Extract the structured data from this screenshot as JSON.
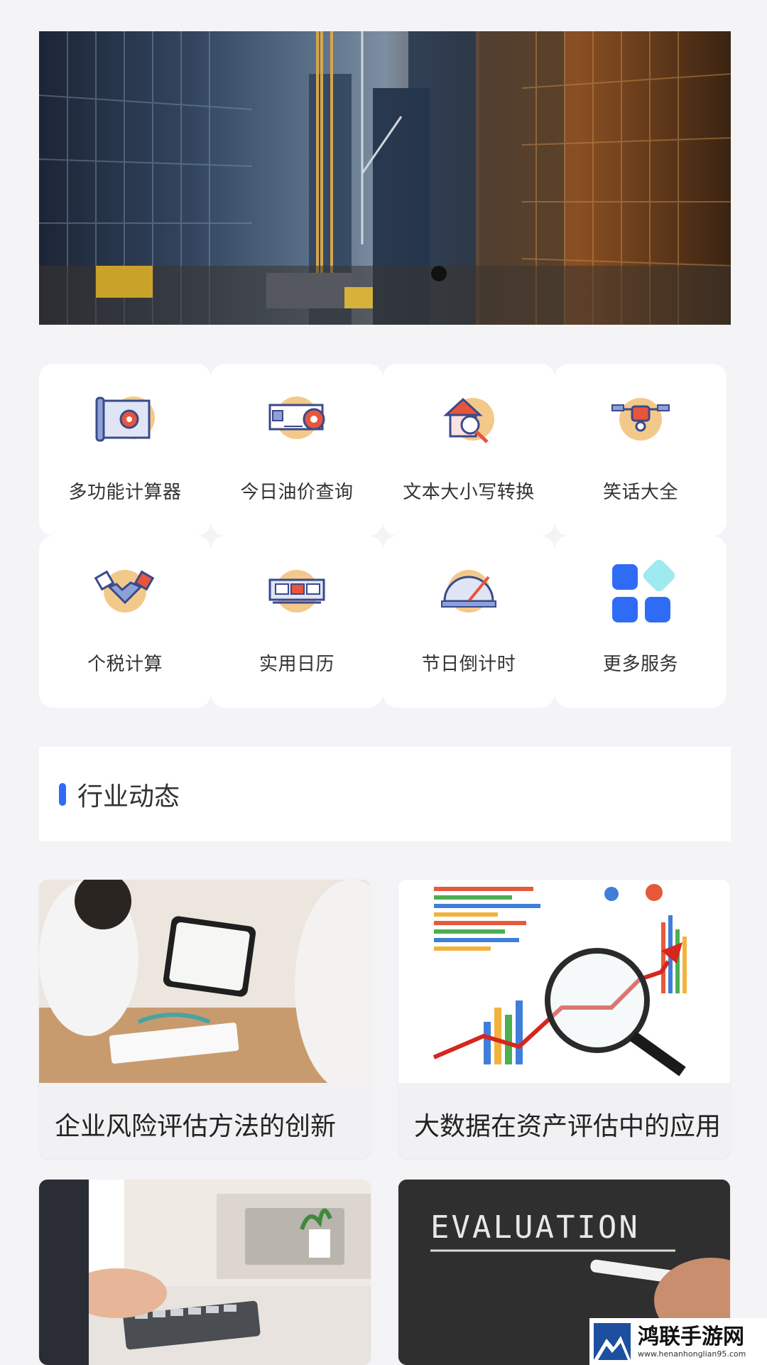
{
  "banner": {
    "image": "construction-city-photo",
    "page_indicator_active": 1
  },
  "services": [
    {
      "label": "多功能计算器",
      "icon": "blueprint-gear-icon"
    },
    {
      "label": "今日油价查询",
      "icon": "measuring-tape-icon"
    },
    {
      "label": "文本大小写转换",
      "icon": "house-magnifier-icon"
    },
    {
      "label": "笑话大全",
      "icon": "drone-icon"
    },
    {
      "label": "个税计算",
      "icon": "handshake-icon"
    },
    {
      "label": "实用日历",
      "icon": "panel-calendar-icon"
    },
    {
      "label": "节日倒计时",
      "icon": "protractor-icon"
    },
    {
      "label": "更多服务",
      "icon": "more-grid-icon"
    }
  ],
  "section": {
    "title": "行业动态"
  },
  "articles": [
    {
      "title": "企业风险评估方法的创新",
      "image": "consultation-photo"
    },
    {
      "title": "大数据在资产评估中的应用",
      "image": "chart-magnifier-photo"
    },
    {
      "title": "",
      "image": "calculator-laptop-photo"
    },
    {
      "title": "",
      "image": "evaluation-chalkboard-photo",
      "image_text": "EVALUATION"
    }
  ],
  "watermark": {
    "name": "鸿联手游网",
    "url": "www.henanhonglian95.com"
  },
  "colors": {
    "accent": "#2f6cf6",
    "icon_circle": "#f3c98b"
  }
}
